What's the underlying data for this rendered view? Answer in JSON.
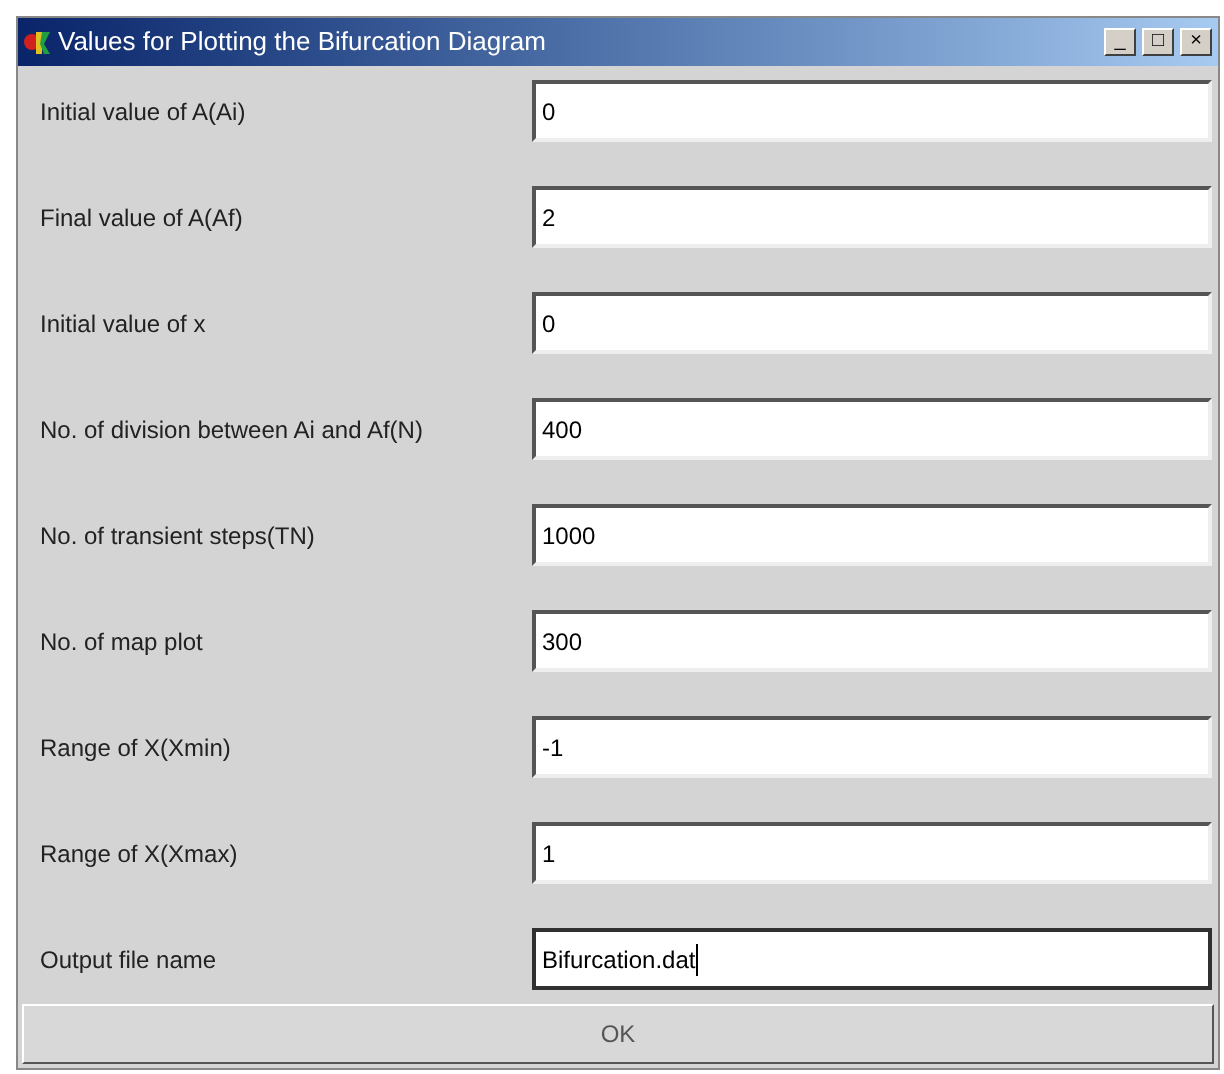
{
  "window": {
    "title": "Values for Plotting the Bifurcation Diagram",
    "controls": [
      "_",
      "□",
      "×"
    ]
  },
  "fields": [
    {
      "label": "Initial value of A(Ai)",
      "value": "0",
      "focused": false
    },
    {
      "label": "Final value of A(Af)",
      "value": "2",
      "focused": false
    },
    {
      "label": "Initial value of x",
      "value": "0",
      "focused": false
    },
    {
      "label": "No. of division between Ai and Af(N)",
      "value": "400",
      "focused": false
    },
    {
      "label": "No. of transient steps(TN)",
      "value": "1000",
      "focused": false
    },
    {
      "label": "No. of map plot",
      "value": "300",
      "focused": false
    },
    {
      "label": "Range of X(Xmin)",
      "value": "-1",
      "focused": false
    },
    {
      "label": "Range of X(Xmax)",
      "value": "1",
      "focused": false
    },
    {
      "label": "Output file name",
      "value": "Bifurcation.dat",
      "focused": true
    }
  ],
  "ok_button": "OK"
}
